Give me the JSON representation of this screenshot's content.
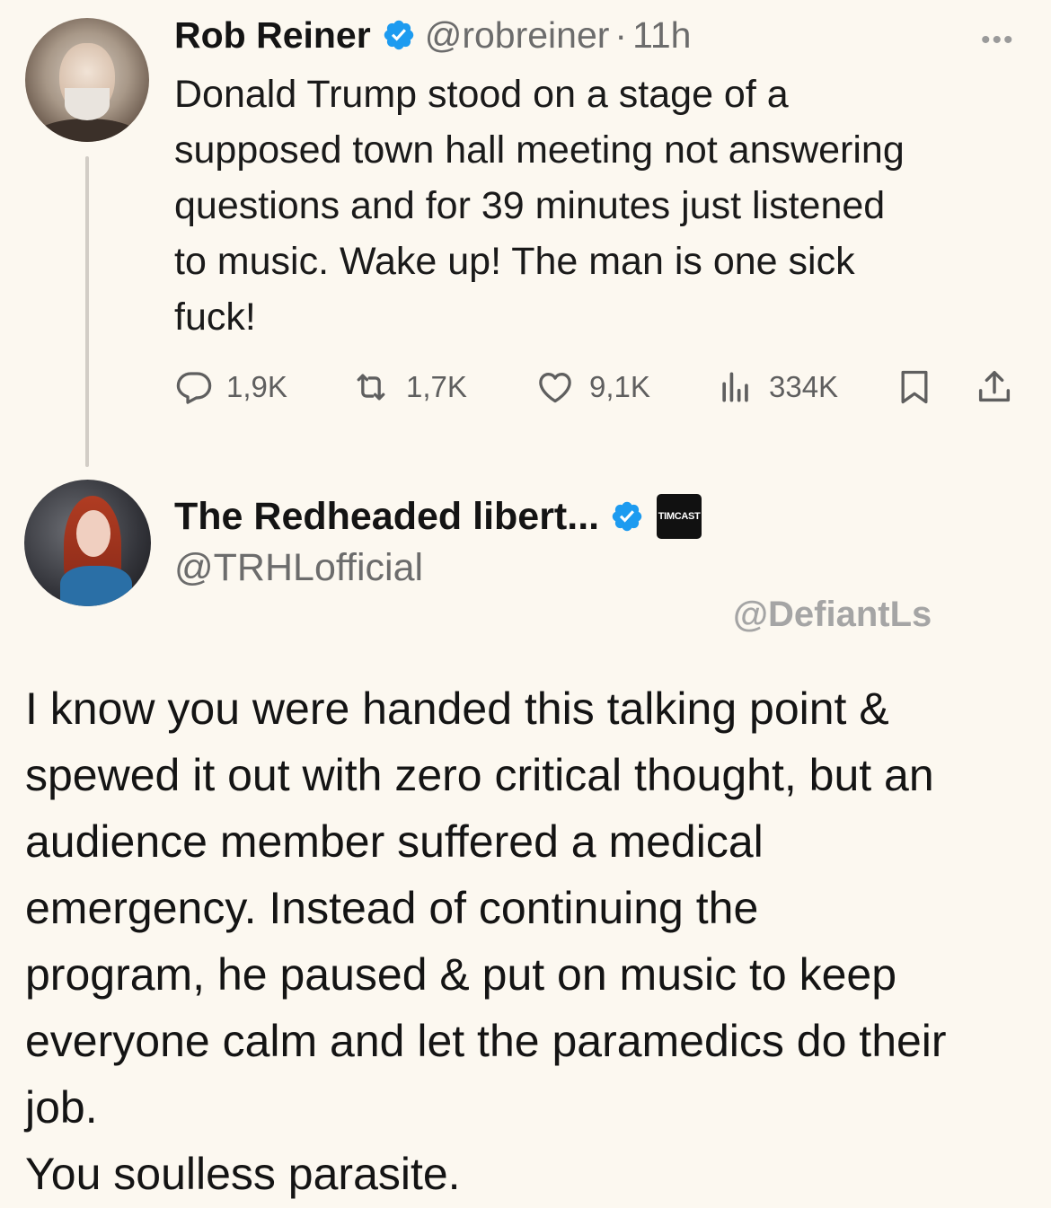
{
  "tweet1": {
    "display_name": "Rob Reiner",
    "handle": "@robreiner",
    "separator": "·",
    "time": "11h",
    "more_icon": "more-dots-icon",
    "text": "Donald Trump stood on a stage of a\nsupposed town hall meeting not answering\nquestions and for 39 minutes just listened\nto music. Wake up! The man is one sick\nfuck!",
    "actions": {
      "replies": "1,9K",
      "reposts": "1,7K",
      "likes": "9,1K",
      "views": "334K"
    }
  },
  "tweet2": {
    "display_name": "The Redheaded libert...",
    "badge_label": "TIMCAST",
    "handle": "@TRHLofficial",
    "text": "I know you were handed this talking point &\nspewed it out with zero critical thought, but an\naudience member suffered a medical\nemergency. Instead of continuing the\nprogram, he paused & put on music to keep\neveryone calm and let the paramedics do their\njob.\nYou soulless parasite."
  },
  "watermark": "@DefiantLs",
  "colors": {
    "background": "#fcf8f0",
    "verified_blue": "#1d9bf0",
    "muted_text": "#6c6c6c"
  }
}
